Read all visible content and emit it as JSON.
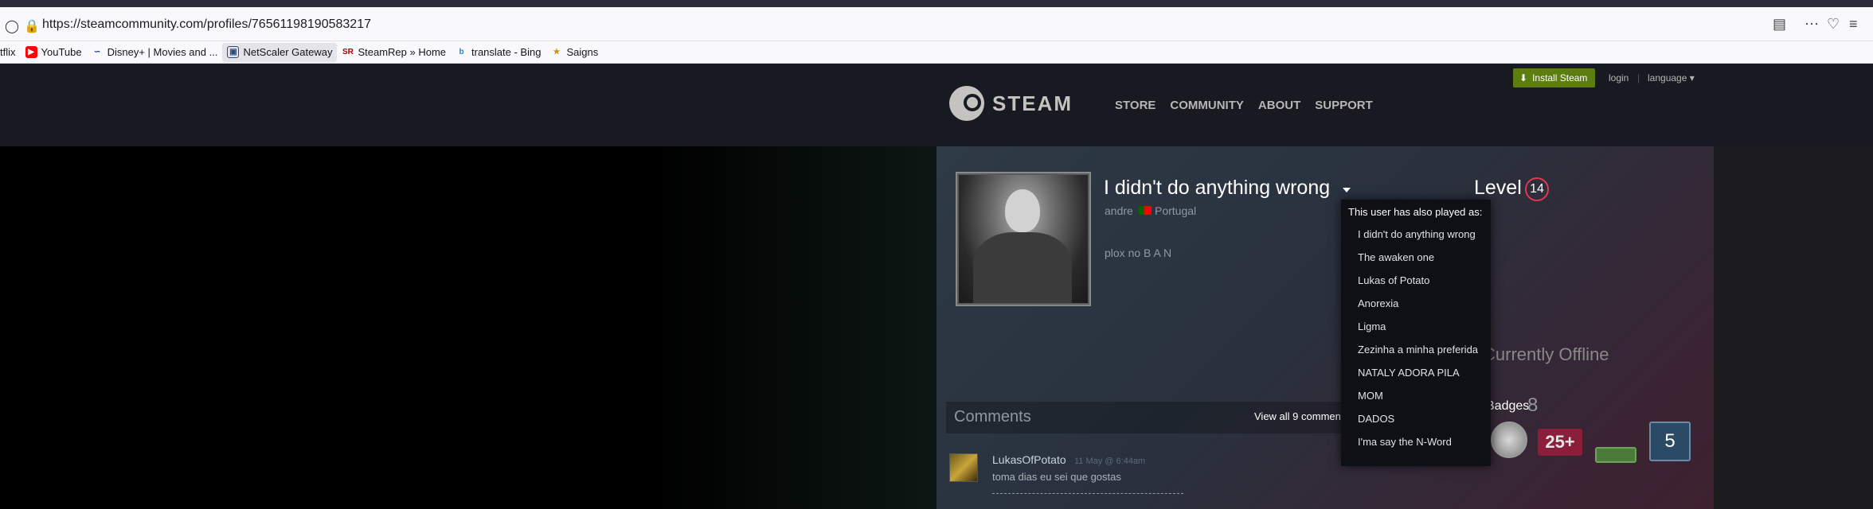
{
  "browser": {
    "url": "https://steamcommunity.com/profiles/76561198190583217",
    "bookmarks": [
      {
        "label": "tflix",
        "icon": "netflix-icon"
      },
      {
        "label": "YouTube",
        "icon": "youtube-icon"
      },
      {
        "label": "Disney+ | Movies and ...",
        "icon": "disney-icon"
      },
      {
        "label": "NetScaler Gateway",
        "icon": "netscaler-icon"
      },
      {
        "label": "SteamRep » Home",
        "icon": "steamrep-icon"
      },
      {
        "label": "translate - Bing",
        "icon": "bing-icon"
      },
      {
        "label": "Saigns",
        "icon": "saigns-icon"
      }
    ]
  },
  "header": {
    "logo_text": "STEAM",
    "nav": [
      "STORE",
      "COMMUNITY",
      "ABOUT",
      "SUPPORT"
    ],
    "install_label": "Install Steam",
    "login_label": "login",
    "separator": "|",
    "language_label": "language"
  },
  "profile": {
    "persona_name": "I didn't do anything wrong",
    "real_name": "andre",
    "country": "Portugal",
    "summary": "plox no B A N",
    "level_label": "Level",
    "level": "14",
    "status": "Currently Offline",
    "badges_label": "Badges",
    "badges_count": "8",
    "badge_25_text": "25+",
    "badge_5_text": "5"
  },
  "alias_menu": {
    "title": "This user has also played as:",
    "items": [
      "I didn't do anything wrong",
      "The awaken one",
      "Lukas of Potato",
      "Anorexia",
      "Ligma",
      "Zezinha a minha preferida",
      "NATALY ADORA PILA",
      "MOM",
      "DADOS",
      "I'ma say the N-Word"
    ]
  },
  "comments": {
    "title": "Comments",
    "view_all": "View all 9 comments",
    "items": [
      {
        "author": "LukasOfPotato",
        "time": "11 May @ 6:44am",
        "text": "toma dias eu sei que gostas"
      }
    ]
  },
  "colors": {
    "accent_install": "#5c7e10",
    "level_ring": "#e4374d",
    "header_bg": "#171a21"
  }
}
